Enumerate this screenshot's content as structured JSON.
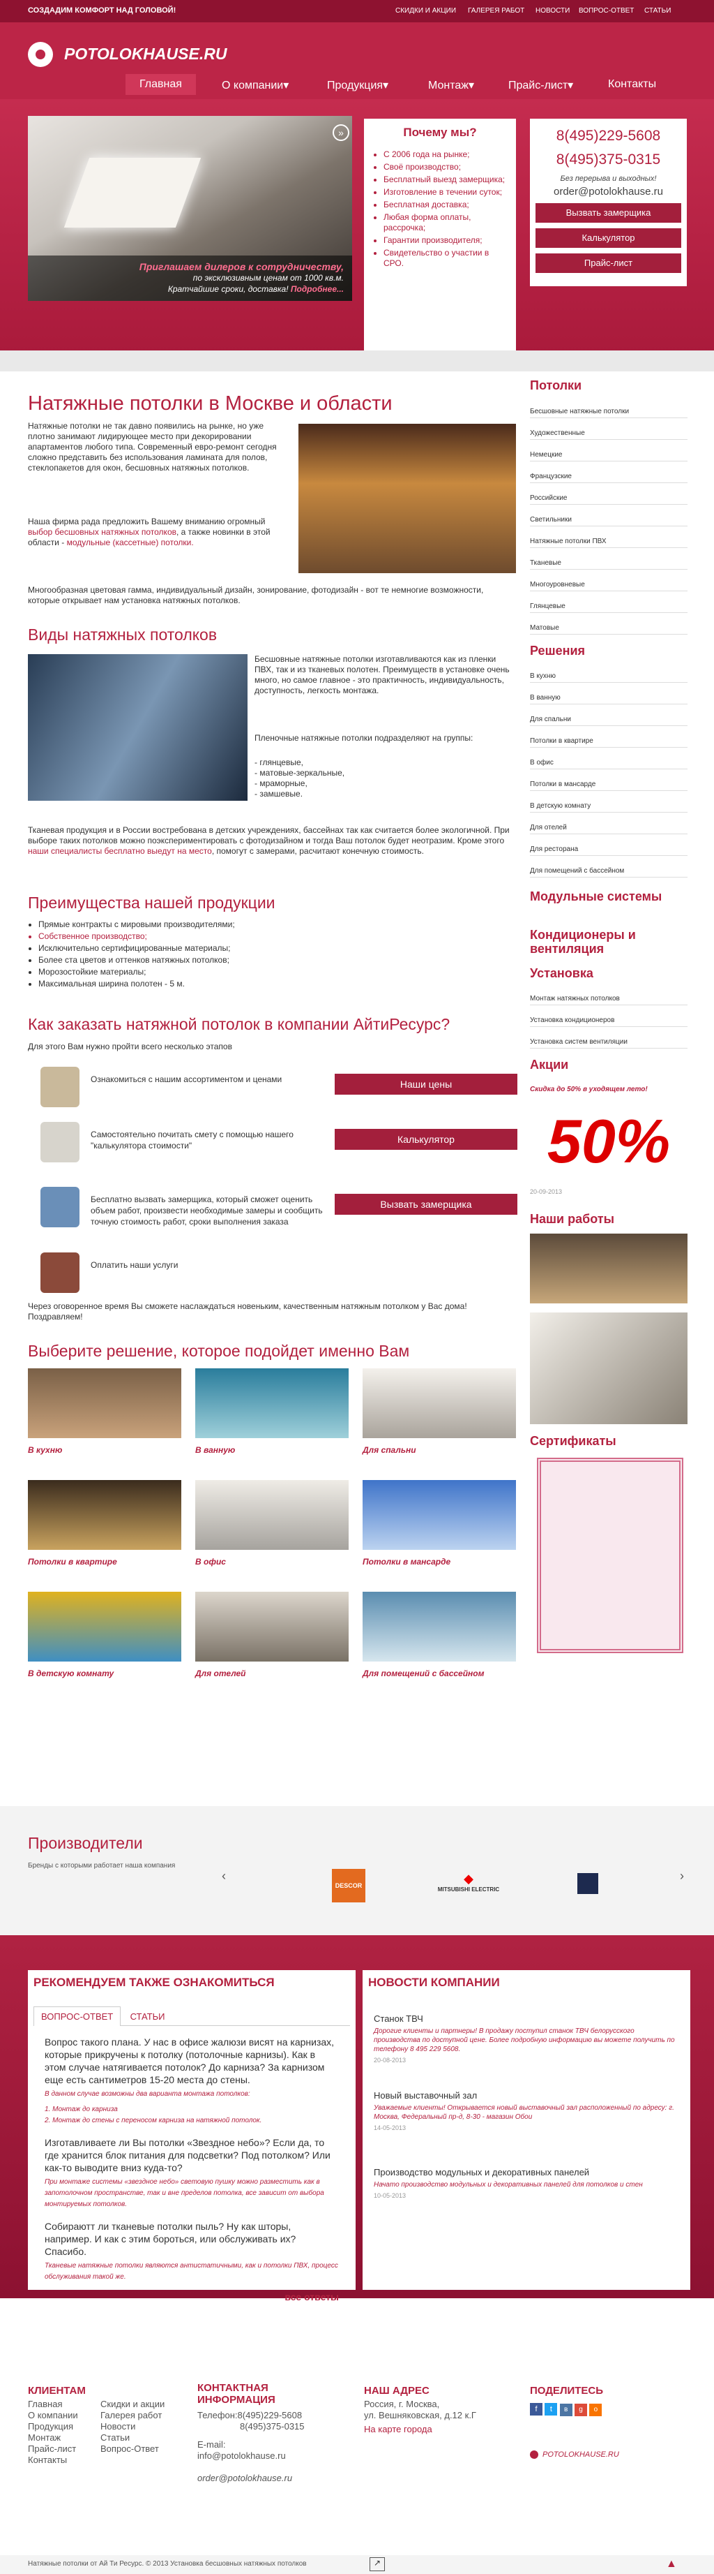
{
  "topbar": {
    "slogan": "СОЗДАДИМ КОМФОРТ НАД ГОЛОВОЙ!",
    "links": [
      "СКИДКИ И АКЦИИ",
      "ГАЛЕРЕЯ РАБОТ",
      "НОВОСТИ",
      "ВОПРОС-ОТВЕТ",
      "СТАТЬИ"
    ]
  },
  "logo": "POTOLOKHAUSE.RU",
  "nav": [
    "Главная",
    "О компании",
    "Продукция",
    "Монтаж",
    "Прайс-лист",
    "Контакты"
  ],
  "hero": {
    "caption_head": "Приглашаем дилеров к сотрудничеству,",
    "caption_l2": "по эксклюзивным ценам от 1000 кв.м.",
    "caption_l3": "Кратчайшие сроки, доставка!",
    "caption_more": "Подробнее...",
    "why_title": "Почему мы?",
    "why_items": [
      "С 2006 года на рынке;",
      "Своё производство;",
      "Бесплатный выезд замерщика;",
      "Изготовление в течении суток;",
      "Бесплатная доставка;",
      "Любая форма оплаты, рассрочка;",
      "Гарантии производителя;",
      "Свидетельство о участии в СРО."
    ],
    "phone1": "8(495)229-5608",
    "phone2": "8(495)375-0315",
    "no_breaks": "Без перерыва и выходных!",
    "email": "order@potolokhause.ru",
    "btn_measurer": "Вызвать замерщика",
    "btn_calc": "Калькулятор",
    "btn_price": "Прайс-лист"
  },
  "main": {
    "title": "Натяжные потолки в Москве и области",
    "p1": "Натяжные потолки не так давно появились на рынке, но уже плотно занимают лидирующее место при декорировании апартаментов любого типа. Современный евро-ремонт сегодня сложно представить без использования ламината для полов, стеклопакетов для окон, бесшовных натяжных потолков.",
    "p2a": "Наша фирма рада предложить Вашему вниманию огромный",
    "p2link": "выбор бесшовных натяжных потолков",
    "p2b": ", а также новинки в этой области -",
    "p2link2": "модульные (кассетные) потолки.",
    "p3": "Многообразная цветовая гамма, индивидуальный дизайн, зонирование, фотодизайн - вот те немногие возможности, которые открывает нам установка натяжных потолков.",
    "types_title": "Виды натяжных потолков",
    "types_p1": "Бесшовные натяжные потолки изготавливаются как из пленки ПВХ, так и из тканевых полотен. Преимуществ в установке очень много, но самое главное - это практичность, индивидуальность, доступность, легкость монтажа.",
    "types_p2": "Пленочные натяжные потолки подразделяют на группы:",
    "types_list": [
      "- глянцевые,",
      "- матовые-зеркальные,",
      "- мраморные,",
      "- замшевые."
    ],
    "types_p3a": "Тканевая продукция и в России востребована в детских учреждениях, бассейнах так как считается более экологичной. При выборе таких потолков можно поэкспериментировать с фотодизайном и тогда Ваш потолок будет неотразим. Кроме этого",
    "types_p3link": "наши специалисты бесплатно выедут на место",
    "types_p3b": ", помогут с замерами, расчитают конечную стоимость.",
    "adv_title": "Преимущества нашей продукции",
    "adv_items": [
      "Прямые контракты с мировыми производителями;",
      "Собственное производство;",
      "Исключительно сертифицированные материалы;",
      "Более ста цветов и оттенков натяжных потолков;",
      "Морозостойкие материалы;",
      "Максимальная ширина полотен - 5 м."
    ],
    "order_title": "Как заказать натяжной потолок в компании АйтиРесурс?",
    "order_sub": "Для этого Вам нужно пройти всего несколько этапов",
    "steps": [
      {
        "text": "Ознакомиться с нашим ассортиментом и ценами",
        "btn": "Наши цены"
      },
      {
        "text": "Самостоятельно почитать смету с помощью нашего \"калькулятора стоимости\"",
        "btn": "Калькулятор"
      },
      {
        "text": "Бесплатно вызвать замерщика, который сможет оценить объем работ, произвести необходимые замеры и сообщить точную стоимость работ, сроки выполнения заказа",
        "btn": "Вызвать замерщика"
      },
      {
        "text": "Оплатить наши услуги",
        "btn": ""
      }
    ],
    "order_final": "Через оговоренное время Вы сможете наслаждаться новеньким, качественным натяжным потолком у Вас дома! Поздравляем!",
    "choose_title": "Выберите решение, которое подойдет именно Вам",
    "choices": [
      "В кухню",
      "В ванную",
      "Для спальни",
      "Потолки в квартире",
      "В офис",
      "Потолки в мансарде",
      "В детскую комнату",
      "Для отелей",
      "Для помещений с бассейном"
    ]
  },
  "side": {
    "ceil_title": "Потолки",
    "ceil": [
      "Бесшовные натяжные потолки",
      "Художественные",
      "Немецкие",
      "Французские",
      "Российские",
      "Светильники",
      "Натяжные потолки ПВХ",
      "Тканевые",
      "Многоуровневые",
      "Глянцевые",
      "Матовые"
    ],
    "sol_title": "Решения",
    "sol": [
      "В кухню",
      "В ванную",
      "Для спальни",
      "Потолки в квартире",
      "В офис",
      "Потолки в мансарде",
      "В детскую комнату",
      "Для отелей",
      "Для ресторана",
      "Для помещений с бассейном"
    ],
    "mod_title": "Модульные системы",
    "cond_title": "Кондиционеры и вентиляция",
    "inst_title": "Установка",
    "inst": [
      "Монтаж натяжных потолков",
      "Установка кондиционеров",
      "Установка систем вентиляции"
    ],
    "promo_title": "Акции",
    "promo_text": "Скидка до 50% в уходящем лето!",
    "promo_big": "50%",
    "promo_date": "20-09-2013",
    "works_title": "Наши работы",
    "cert_title": "Сертификаты"
  },
  "makers": {
    "title": "Производители",
    "sub": "Бренды с которыми работает наша компания",
    "brands": [
      "DESCOR",
      "MITSUBISHI ELECTRIC"
    ]
  },
  "rec": {
    "title": "РЕКОМЕНДУЕМ ТАКЖЕ ОЗНАКОМИТЬСЯ",
    "tab1": "ВОПРОС-ОТВЕТ",
    "tab2": "СТАТЬИ",
    "q1": "Вопрос такого плана. У нас в офисе жалюзи висят на карнизах, которые прикручены к потолку (потолочные карнизы). Как в этом случае натягивается потолок? До карниза? За карнизом еще есть сантиметров 15-20 места до стены.",
    "q1a": "В данном случае возможны два варианта монтажа потолков:",
    "q1b": "1. Монтаж до карниза",
    "q1c": "2. Монтаж до стены с переносом карниза на натяжной потолок.",
    "q2": "Изготавливаете ли Вы потолки «Звездное небо»? Если да, то где хранится блок питания для подсветки? Под потолком? Или как-то выводите вниз куда-то?",
    "q2a": "При монтаже системы «звездное небо» световую пушку можно разместить как в запотолочном пространстве, так и вне пределов потолка, все зависит от выбора монтируемых потолков.",
    "q3": "Собираютт ли тканевые потолки пыль? Ну как шторы, например. И как с этим бороться, или обслуживать их? Спасибо.",
    "q3a": "Тканевые натяжные потолки являются антистатичными, как и потолки ПВХ, процесс обслуживания такой же.",
    "all": "все ответы"
  },
  "news": {
    "title": "НОВОСТИ КОМПАНИИ",
    "items": [
      {
        "t": "Станок ТВЧ",
        "d": "Дорогие клиенты и партнеры! В продажу поступил станок ТВЧ белорусского производства по доступной цене. Более подробную информацию вы можете получить по телефону 8 495 229 5608.",
        "date": "20-08-2013"
      },
      {
        "t": "Новый выставочный зал",
        "d": "Уважаемые клиенты! Открывается новый выставочный зал расположенный по адресу: г. Москва, Федеральный пр-д, 8-30 - магазин Обои",
        "date": "14-05-2013"
      },
      {
        "t": "Производство модульных и декоративных панелей",
        "d": "Начато производство модульных и декоративных панелей для потолков и стен",
        "date": "10-05-2013"
      }
    ]
  },
  "footer": {
    "clients": "КЛИЕНТАМ",
    "col1": [
      "Главная",
      "О компании",
      "Продукция",
      "Монтаж",
      "Прайс-лист",
      "Контакты"
    ],
    "col2": [
      "Скидки и акции",
      "Галерея работ",
      "Новости",
      "Статьи",
      "Вопрос-Ответ"
    ],
    "contact_title": "КОНТАКТНАЯ ИНФОРМАЦИЯ",
    "tel_label": "Телефон:",
    "tel1": "8(495)229-5608",
    "tel2": "8(495)375-0315",
    "email_label": "E-mail:",
    "email": "info@potolokhause.ru",
    "email2": "order@potolokhause.ru",
    "addr_title": "НАШ АДРЕС",
    "addr1": "Россия, г. Москва,",
    "addr2": "ул. Вешняковская, д.12 к.Г",
    "map": "На карте города",
    "share_title": "ПОДЕЛИТЕСЬ",
    "site": "POTOLOKHAUSE.RU",
    "copyright": "Натяжные потолки от Ай Ти Ресурс. © 2013 Установка бесшовных натяжных потолков"
  },
  "colors": {
    "brand": "#b3213f",
    "dark": "#8e1230",
    "light": "#bc2547"
  }
}
